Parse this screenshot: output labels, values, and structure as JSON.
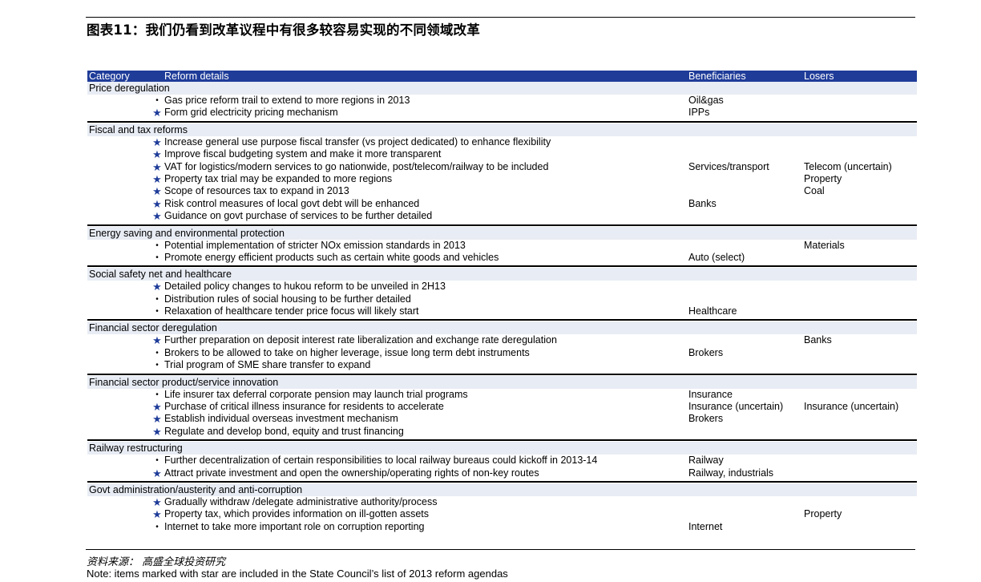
{
  "title": "图表11：我们仍看到改革议程中有很多较容易实现的不同领域改革",
  "headers": {
    "category": "Category",
    "details": "Reform details",
    "beneficiaries": "Beneficiaries",
    "losers": "Losers"
  },
  "sections": [
    {
      "category": "Price deregulation",
      "rows": [
        {
          "mark": "bullet",
          "detail": "Gas price reform trail to extend to more regions in 2013",
          "beneficiaries": "Oil&gas",
          "losers": ""
        },
        {
          "mark": "star",
          "detail": "Form grid electricity pricing mechanism",
          "beneficiaries": "IPPs",
          "losers": ""
        }
      ]
    },
    {
      "category": "Fiscal and tax reforms",
      "rows": [
        {
          "mark": "star",
          "detail": "Increase general use purpose fiscal transfer (vs project dedicated) to enhance flexibility",
          "beneficiaries": "",
          "losers": ""
        },
        {
          "mark": "star",
          "detail": "Improve fiscal budgeting system and make it more transparent",
          "beneficiaries": "",
          "losers": ""
        },
        {
          "mark": "star",
          "detail": "VAT for logistics/modern services to go nationwide, post/telecom/railway to be included",
          "beneficiaries": "Services/transport",
          "losers": "Telecom (uncertain)"
        },
        {
          "mark": "star",
          "detail": "Property tax trial may be expanded to more regions",
          "beneficiaries": "",
          "losers": "Property"
        },
        {
          "mark": "star",
          "detail": "Scope of resources tax to expand in 2013",
          "beneficiaries": "",
          "losers": "Coal"
        },
        {
          "mark": "star",
          "detail": "Risk control measures of local govt debt will be enhanced",
          "beneficiaries": "Banks",
          "losers": ""
        },
        {
          "mark": "star",
          "detail": "Guidance on govt purchase of services to be further detailed",
          "beneficiaries": "",
          "losers": ""
        }
      ]
    },
    {
      "category": "Energy saving and environmental protection",
      "rows": [
        {
          "mark": "bullet",
          "detail": "Potential implementation of stricter NOx emission standards in 2013",
          "beneficiaries": "",
          "losers": "Materials"
        },
        {
          "mark": "bullet",
          "detail": "Promote energy efficient products such as certain white goods and vehicles",
          "beneficiaries": "Auto (select)",
          "losers": ""
        }
      ]
    },
    {
      "category": "Social safety net and healthcare",
      "rows": [
        {
          "mark": "star",
          "detail": "Detailed policy changes to hukou reform to be unveiled in 2H13",
          "beneficiaries": "",
          "losers": ""
        },
        {
          "mark": "bullet",
          "detail": "Distribution rules of social housing to be further detailed",
          "beneficiaries": "",
          "losers": ""
        },
        {
          "mark": "bullet",
          "detail": "Relaxation of healthcare tender price focus will likely start",
          "beneficiaries": "Healthcare",
          "losers": ""
        }
      ]
    },
    {
      "category": "Financial sector deregulation",
      "rows": [
        {
          "mark": "star",
          "detail": "Further preparation on deposit interest rate liberalization and exchange rate deregulation",
          "beneficiaries": "",
          "losers": "Banks"
        },
        {
          "mark": "bullet",
          "detail": "Brokers to be allowed to take on higher leverage, issue long term debt instruments",
          "beneficiaries": "Brokers",
          "losers": ""
        },
        {
          "mark": "bullet",
          "detail": "Trial program of SME share transfer to expand",
          "beneficiaries": "",
          "losers": ""
        }
      ]
    },
    {
      "category": "Financial sector product/service innovation",
      "rows": [
        {
          "mark": "bullet",
          "detail": "Life insurer tax deferral corporate pension may launch trial programs",
          "beneficiaries": "Insurance",
          "losers": ""
        },
        {
          "mark": "star",
          "detail": "Purchase of critical illness insurance for residents to accelerate",
          "beneficiaries": "Insurance (uncertain)",
          "losers": "Insurance (uncertain)"
        },
        {
          "mark": "star",
          "detail": "Establish individual overseas investment mechanism",
          "beneficiaries": "Brokers",
          "losers": ""
        },
        {
          "mark": "star",
          "detail": "Regulate and develop bond, equity and trust financing",
          "beneficiaries": "",
          "losers": ""
        }
      ]
    },
    {
      "category": "Railway restructuring",
      "rows": [
        {
          "mark": "bullet",
          "detail": "Further decentralization of certain responsibilities to local railway bureaus could kickoff in 2013-14",
          "beneficiaries": "Railway",
          "losers": ""
        },
        {
          "mark": "star",
          "detail": "Attract private investment and open the ownership/operating rights of non-key routes",
          "beneficiaries": "Railway, industrials",
          "losers": ""
        }
      ]
    },
    {
      "category": "Govt administration/austerity and anti-corruption",
      "rows": [
        {
          "mark": "star",
          "detail": "Gradually withdraw /delegate administrative authority/process",
          "beneficiaries": "",
          "losers": ""
        },
        {
          "mark": "star",
          "detail": "Property tax, which provides information on ill-gotten assets",
          "beneficiaries": "",
          "losers": "Property"
        },
        {
          "mark": "bullet",
          "detail": "Internet to take more important role on corruption reporting",
          "beneficiaries": "Internet",
          "losers": ""
        }
      ]
    }
  ],
  "source": "资料来源：  高盛全球投资研究",
  "note": "Note: items marked with star are included in the State Council’s list of 2013 reform agendas"
}
